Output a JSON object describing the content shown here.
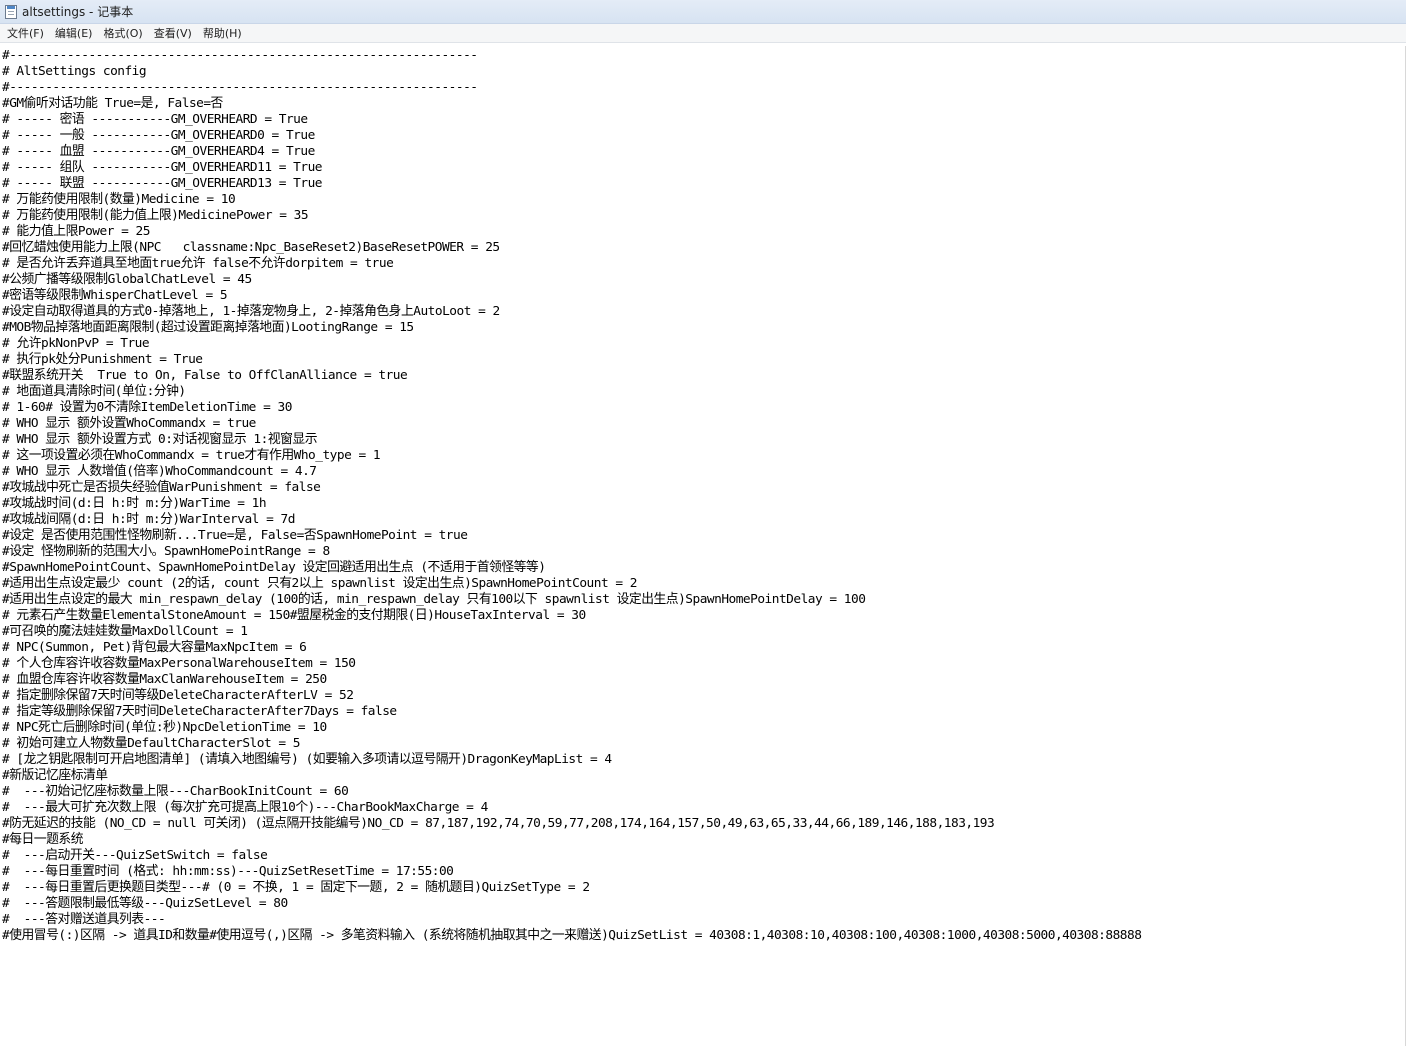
{
  "window": {
    "title": "altsettings - 记事本",
    "icon": "notepad-icon"
  },
  "menu": [
    {
      "label": "文件(F)"
    },
    {
      "label": "编辑(E)"
    },
    {
      "label": "格式(O)"
    },
    {
      "label": "查看(V)"
    },
    {
      "label": "帮助(H)"
    }
  ],
  "editor": {
    "lines": [
      "#-----------------------------------------------------------------",
      "# AltSettings config",
      "#-----------------------------------------------------------------",
      "#GM偷听对话功能 True=是, False=否",
      "# ----- 密语 -----------GM_OVERHEARD = True",
      "# ----- 一般 -----------GM_OVERHEARD0 = True",
      "# ----- 血盟 -----------GM_OVERHEARD4 = True",
      "# ----- 组队 -----------GM_OVERHEARD11 = True",
      "# ----- 联盟 -----------GM_OVERHEARD13 = True",
      "# 万能药使用限制(数量)Medicine = 10",
      "# 万能药使用限制(能力值上限)MedicinePower = 35",
      "# 能力值上限Power = 25",
      "#回忆蜡烛使用能力上限(NPC   classname:Npc_BaseReset2)BaseResetPOWER = 25",
      "# 是否允许丢弃道具至地面true允许 false不允许dorpitem = true",
      "#公频广播等级限制GlobalChatLevel = 45",
      "#密语等级限制WhisperChatLevel = 5",
      "#设定自动取得道具的方式0-掉落地上, 1-掉落宠物身上, 2-掉落角色身上AutoLoot = 2",
      "#MOB物品掉落地面距离限制(超过设置距离掉落地面)LootingRange = 15",
      "# 允许pkNonPvP = True",
      "# 执行pk处分Punishment = True",
      "#联盟系统开关  True to On, False to OffClanAlliance = true",
      "# 地面道具清除时间(单位:分钟)",
      "# 1-60# 设置为0不清除ItemDeletionTime = 30",
      "# WHO 显示 额外设置WhoCommandx = true",
      "# WHO 显示 额外设置方式 0:对话视窗显示 1:视窗显示",
      "# 这一项设置必须在WhoCommandx = true才有作用Who_type = 1",
      "# WHO 显示 人数增值(倍率)WhoCommandcount = 4.7",
      "#攻城战中死亡是否损失经验值WarPunishment = false",
      "#攻城战时间(d:日 h:时 m:分)WarTime = 1h",
      "#攻城战间隔(d:日 h:时 m:分)WarInterval = 7d",
      "#设定 是否使用范围性怪物刷新...True=是, False=否SpawnHomePoint = true",
      "#设定 怪物刷新的范围大小。SpawnHomePointRange = 8",
      "#SpawnHomePointCount、SpawnHomePointDelay 设定回避适用出生点 (不适用于首领怪等等)",
      "#适用出生点设定最少 count (2的话, count 只有2以上 spawnlist 设定出生点)SpawnHomePointCount = 2",
      "#适用出生点设定的最大 min_respawn_delay (100的话, min_respawn_delay 只有100以下 spawnlist 设定出生点)SpawnHomePointDelay = 100",
      "# 元素石产生数量ElementalStoneAmount = 150#盟屋税金的支付期限(日)HouseTaxInterval = 30",
      "#可召唤的魔法娃娃数量MaxDollCount = 1",
      "# NPC(Summon, Pet)背包最大容量MaxNpcItem = 6",
      "# 个人仓库容许收容数量MaxPersonalWarehouseItem = 150",
      "# 血盟仓库容许收容数量MaxClanWarehouseItem = 250",
      "# 指定删除保留7天时间等级DeleteCharacterAfterLV = 52",
      "# 指定等级删除保留7天时间DeleteCharacterAfter7Days = false",
      "# NPC死亡后删除时间(单位:秒)NpcDeletionTime = 10",
      "# 初始可建立人物数量DefaultCharacterSlot = 5",
      "# [龙之钥匙限制可开启地图清单] (请填入地图编号) (如要输入多项请以逗号隔开)DragonKeyMapList = 4",
      "#新版记忆座标清单",
      "#  ---初始记忆座标数量上限---CharBookInitCount = 60",
      "#  ---最大可扩充次数上限 (每次扩充可提高上限10个)---CharBookMaxCharge = 4",
      "#防无延迟的技能 (NO_CD = null 可关闭) (逗点隔开技能编号)NO_CD = 87,187,192,74,70,59,77,208,174,164,157,50,49,63,65,33,44,66,189,146,188,183,193",
      "#每日一题系统",
      "#  ---启动开关---QuizSetSwitch = false",
      "#  ---每日重置时间 (格式: hh:mm:ss)---QuizSetResetTime = 17:55:00",
      "#  ---每日重置后更换题目类型---# (0 = 不换, 1 = 固定下一题, 2 = 随机题目)QuizSetType = 2",
      "#  ---答题限制最低等级---QuizSetLevel = 80",
      "#  ---答对赠送道具列表---",
      "#使用冒号(:)区隔 -> 道具ID和数量#使用逗号(,)区隔 -> 多笔资料输入 (系统将随机抽取其中之一来赠送)QuizSetList = 40308:1,40308:10,40308:100,40308:1000,40308:5000,40308:88888"
    ]
  }
}
